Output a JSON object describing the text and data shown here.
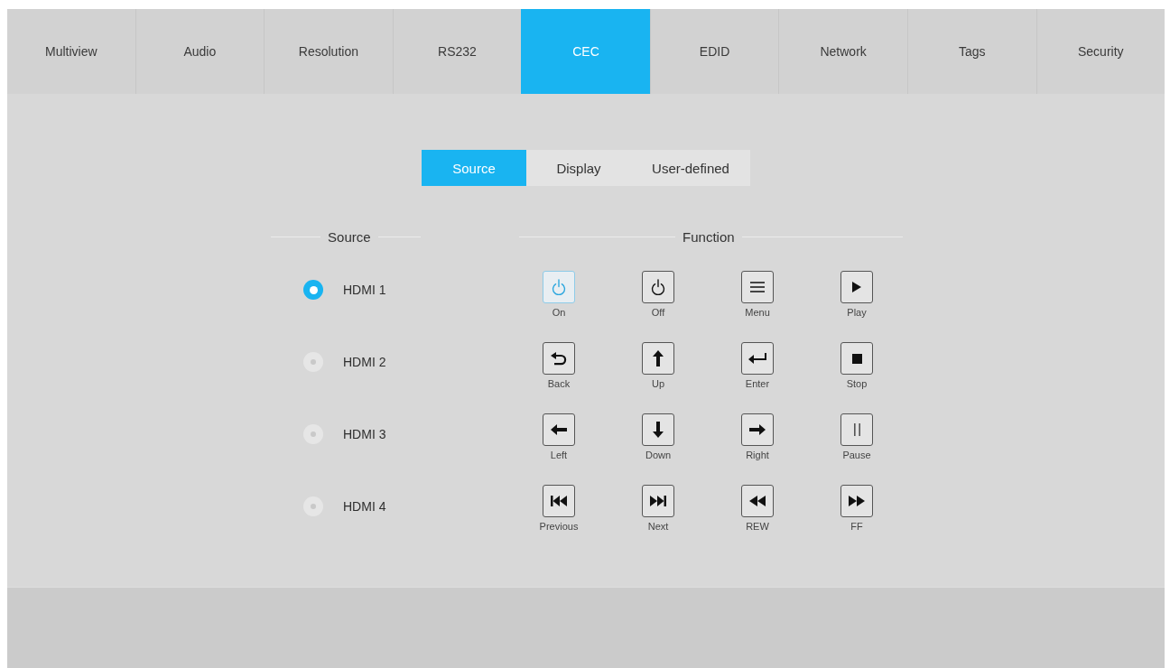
{
  "tabs": [
    {
      "label": "Multiview",
      "selected": false
    },
    {
      "label": "Audio",
      "selected": false
    },
    {
      "label": "Resolution",
      "selected": false
    },
    {
      "label": "RS232",
      "selected": false
    },
    {
      "label": "CEC",
      "selected": true
    },
    {
      "label": "EDID",
      "selected": false
    },
    {
      "label": "Network",
      "selected": false
    },
    {
      "label": "Tags",
      "selected": false
    },
    {
      "label": "Security",
      "selected": false
    }
  ],
  "subtabs": [
    {
      "label": "Source",
      "selected": true
    },
    {
      "label": "Display",
      "selected": false
    },
    {
      "label": "User-defined",
      "selected": false
    }
  ],
  "source": {
    "heading": "Source",
    "options": [
      {
        "label": "HDMI 1",
        "selected": true
      },
      {
        "label": "HDMI 2",
        "selected": false
      },
      {
        "label": "HDMI 3",
        "selected": false
      },
      {
        "label": "HDMI 4",
        "selected": false
      }
    ]
  },
  "function": {
    "heading": "Function",
    "keys": [
      {
        "label": "On",
        "kind": "power",
        "highlighted": true
      },
      {
        "label": "Off",
        "kind": "power",
        "highlighted": false
      },
      {
        "label": "Menu",
        "kind": "menu",
        "highlighted": false
      },
      {
        "label": "Play",
        "kind": "play",
        "highlighted": false
      },
      {
        "label": "Back",
        "kind": "back",
        "highlighted": false
      },
      {
        "label": "Up",
        "kind": "up",
        "highlighted": false
      },
      {
        "label": "Enter",
        "kind": "enter",
        "highlighted": false
      },
      {
        "label": "Stop",
        "kind": "stop",
        "highlighted": false
      },
      {
        "label": "Left",
        "kind": "left",
        "highlighted": false
      },
      {
        "label": "Down",
        "kind": "down",
        "highlighted": false
      },
      {
        "label": "Right",
        "kind": "right",
        "highlighted": false
      },
      {
        "label": "Pause",
        "kind": "pause",
        "highlighted": false
      },
      {
        "label": "Previous",
        "kind": "previous",
        "highlighted": false
      },
      {
        "label": "Next",
        "kind": "next",
        "highlighted": false
      },
      {
        "label": "REW",
        "kind": "rewind",
        "highlighted": false
      },
      {
        "label": "FF",
        "kind": "fast_forward",
        "highlighted": false
      }
    ]
  }
}
